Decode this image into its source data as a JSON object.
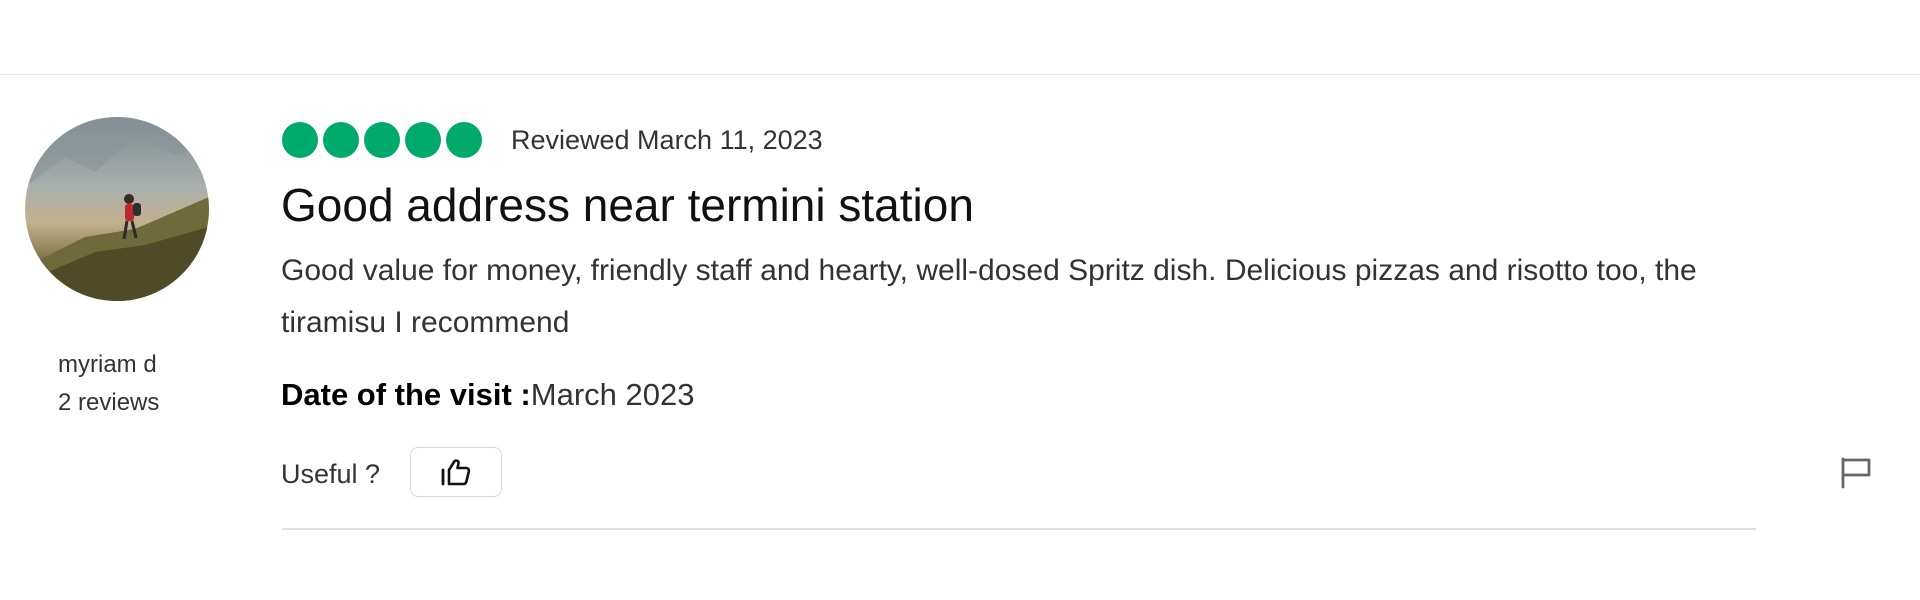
{
  "review": {
    "author": {
      "name": "myriam d",
      "review_count": "2 reviews"
    },
    "rating": {
      "value": 5,
      "max": 5,
      "color": "#00aa6c"
    },
    "reviewed_date": "Reviewed March 11, 2023",
    "title": "Good address near termini station",
    "body": "Good value for money, friendly staff and hearty, well-dosed Spritz dish. Delicious pizzas and risotto too, the tiramisu I recommend",
    "visit": {
      "label": "Date of the visit :",
      "value": "March 2023"
    },
    "useful_label": "Useful ?",
    "icons": {
      "helpful": "thumbs-up-icon",
      "report": "flag-icon"
    }
  }
}
